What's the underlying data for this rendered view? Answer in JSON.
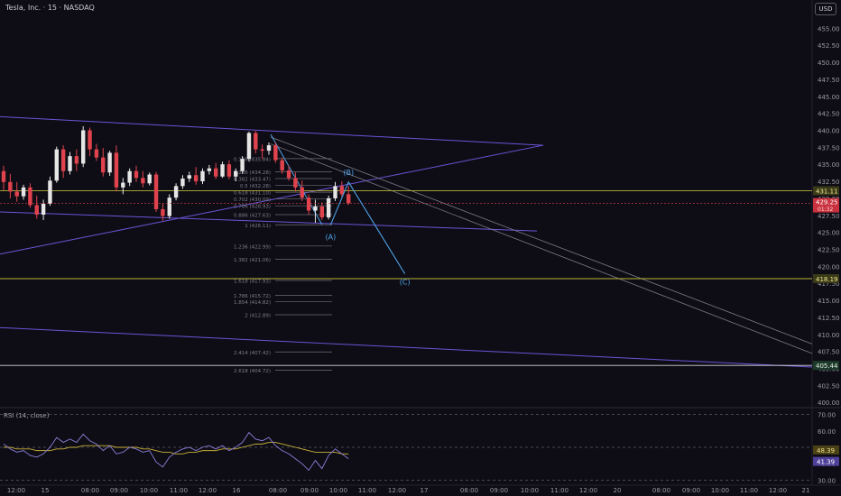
{
  "header": {
    "symbol": "Tesla, Inc. · 15 · NASDAQ",
    "currency": "USD"
  },
  "colors": {
    "bg": "#0e0d15",
    "up": "#e6e6e6",
    "down": "#e0434d",
    "channel": "#6a55d8",
    "fib": "#6d6d78",
    "level": "#b8b23a",
    "wave": "#4fa3e8",
    "rsi": "#8b7ed8",
    "rsiMa": "#c9b13a"
  },
  "chart_data": [
    {
      "type": "candlestick",
      "title": "",
      "yticks": [
        455.0,
        452.5,
        450.0,
        447.5,
        445.0,
        442.5,
        440.0,
        437.5,
        435.0,
        432.5,
        430.0,
        427.5,
        425.0,
        422.5,
        420.0,
        417.5,
        415.0,
        412.5,
        410.0,
        407.5,
        405.0,
        402.5,
        400.0
      ],
      "ylim": [
        399.5,
        456.5
      ],
      "xticks": [
        "12:00",
        "15",
        "08:00",
        "09:00",
        "10:00",
        "11:00",
        "12:00",
        "16",
        "08:00",
        "09:00",
        "10:00",
        "11:00",
        "12:00",
        "17",
        "08:00",
        "09:00",
        "10:00",
        "11:00",
        "12:00",
        "20",
        "08:00",
        "09:00",
        "10:00",
        "11:00",
        "12:00",
        "21"
      ],
      "x_note": "bar index (0..61 candles shown)",
      "candles": [
        [
          434.0,
          434.8,
          431.2,
          432.4
        ],
        [
          432.4,
          433.6,
          430.0,
          431.0
        ],
        [
          431.0,
          432.4,
          429.5,
          430.3
        ],
        [
          430.3,
          432.0,
          429.8,
          431.6
        ],
        [
          431.6,
          432.2,
          428.6,
          429.0
        ],
        [
          429.0,
          430.4,
          427.0,
          427.6
        ],
        [
          427.6,
          429.8,
          426.8,
          429.2
        ],
        [
          429.2,
          433.2,
          428.9,
          432.6
        ],
        [
          432.6,
          437.6,
          432.3,
          437.2
        ],
        [
          437.2,
          437.8,
          433.0,
          434.0
        ],
        [
          434.0,
          436.8,
          433.5,
          436.2
        ],
        [
          436.2,
          437.2,
          434.0,
          435.1
        ],
        [
          435.1,
          440.6,
          434.6,
          440.0
        ],
        [
          440.0,
          440.4,
          436.2,
          437.2
        ],
        [
          437.2,
          438.0,
          435.5,
          436.0
        ],
        [
          436.0,
          437.4,
          433.2,
          433.8
        ],
        [
          433.8,
          437.0,
          433.3,
          436.7
        ],
        [
          436.7,
          437.8,
          431.0,
          431.6
        ],
        [
          431.6,
          433.0,
          430.6,
          432.3
        ],
        [
          432.3,
          434.4,
          431.8,
          434.0
        ],
        [
          434.0,
          434.8,
          432.4,
          433.0
        ],
        [
          433.0,
          434.0,
          431.6,
          432.2
        ],
        [
          432.2,
          433.8,
          431.9,
          433.5
        ],
        [
          433.5,
          433.9,
          428.0,
          428.4
        ],
        [
          428.4,
          429.2,
          426.7,
          427.4
        ],
        [
          427.4,
          430.6,
          427.0,
          430.1
        ],
        [
          430.1,
          432.2,
          429.7,
          431.8
        ],
        [
          431.8,
          433.4,
          431.4,
          432.9
        ],
        [
          432.9,
          433.9,
          432.4,
          433.4
        ],
        [
          433.4,
          434.6,
          432.0,
          432.5
        ],
        [
          432.5,
          434.4,
          432.1,
          434.0
        ],
        [
          434.0,
          434.9,
          433.5,
          434.4
        ],
        [
          434.4,
          435.2,
          432.8,
          433.2
        ],
        [
          433.2,
          435.4,
          433.0,
          435.0
        ],
        [
          435.0,
          435.6,
          432.8,
          433.2
        ],
        [
          433.2,
          434.4,
          432.5,
          434.0
        ],
        [
          434.0,
          436.2,
          433.6,
          435.8
        ],
        [
          435.8,
          439.8,
          435.4,
          439.6
        ],
        [
          439.6,
          439.9,
          436.6,
          437.2
        ],
        [
          437.2,
          437.9,
          435.8,
          437.0
        ],
        [
          437.0,
          438.2,
          436.4,
          437.8
        ],
        [
          437.8,
          438.2,
          435.2,
          435.6
        ],
        [
          435.6,
          436.0,
          433.6,
          434.1
        ],
        [
          434.1,
          434.8,
          432.6,
          433.0
        ],
        [
          433.0,
          433.8,
          431.0,
          431.6
        ],
        [
          431.6,
          432.6,
          429.6,
          430.1
        ],
        [
          430.1,
          430.6,
          427.6,
          428.2
        ],
        [
          428.2,
          429.8,
          426.4,
          428.8
        ],
        [
          428.8,
          429.4,
          426.8,
          427.2
        ],
        [
          427.2,
          430.4,
          426.9,
          430.0
        ],
        [
          430.0,
          432.4,
          429.6,
          431.8
        ],
        [
          431.8,
          432.5,
          430.2,
          430.6
        ],
        [
          430.6,
          431.8,
          429.0,
          429.3
        ]
      ],
      "levels": [
        {
          "price": 431.11,
          "label": "431.11"
        },
        {
          "price": 418.19,
          "label": "418.19"
        },
        {
          "price": 405.44,
          "label": "405.44"
        }
      ],
      "current_price": {
        "price": 429.25,
        "label": "429.25",
        "countdown": "01:32"
      },
      "fib": [
        {
          "ratio": "0.146",
          "price": "435.84",
          "y": 435.84
        },
        {
          "ratio": "0.236",
          "price": "434.28",
          "y": 433.9
        },
        {
          "ratio": "0.382",
          "price": "433.47",
          "y": 432.9
        },
        {
          "ratio": "0.5",
          "price": "432.28",
          "y": 431.9
        },
        {
          "ratio": "0.618",
          "price": "431.10",
          "y": 430.9
        },
        {
          "ratio": "0.702",
          "price": "430.09",
          "y": 429.9
        },
        {
          "ratio": "0.786",
          "price": "428.93",
          "y": 428.9
        },
        {
          "ratio": "0.886",
          "price": "427.63",
          "y": 427.6
        },
        {
          "ratio": "1",
          "price": "426.11",
          "y": 426.11
        },
        {
          "ratio": "1.236",
          "price": "422.99",
          "y": 422.99
        },
        {
          "ratio": "1.382",
          "price": "421.06",
          "y": 421.06
        },
        {
          "ratio": "1.618",
          "price": "417.93",
          "y": 417.93
        },
        {
          "ratio": "1.786",
          "price": "415.72",
          "y": 415.72
        },
        {
          "ratio": "1.854",
          "price": "414.82",
          "y": 414.82
        },
        {
          "ratio": "2",
          "price": "412.89",
          "y": 412.89
        },
        {
          "ratio": "2.414",
          "price": "407.42",
          "y": 407.42
        },
        {
          "ratio": "2.618",
          "price": "404.72",
          "y": 404.72
        }
      ],
      "waves": [
        {
          "label": "(A)",
          "x": 49.5,
          "price": 426.1
        },
        {
          "label": "(B)",
          "x": 52.0,
          "price": 432.4
        },
        {
          "label": "(C)",
          "x": 60.5,
          "price": 418.9
        }
      ]
    },
    {
      "type": "line",
      "title": "RSI (14, close)",
      "ylim": [
        28,
        72
      ],
      "yticks": [
        70.0,
        60.0,
        50.0,
        40.0,
        30.0
      ],
      "series": [
        {
          "values": [
            52,
            49,
            47,
            48,
            45,
            44,
            46,
            50,
            56,
            53,
            55,
            53,
            58,
            54,
            52,
            48,
            51,
            46,
            47,
            50,
            49,
            47,
            48,
            41,
            38,
            44,
            47,
            49,
            50,
            48,
            50,
            51,
            49,
            51,
            48,
            50,
            53,
            59,
            55,
            54,
            56,
            51,
            48,
            46,
            43,
            40,
            36,
            42,
            37,
            45,
            49,
            46,
            43
          ]
        },
        {
          "values": [
            50,
            50,
            49,
            49,
            49,
            48,
            48,
            48,
            49,
            49,
            50,
            50,
            51,
            51,
            51,
            51,
            51,
            50,
            50,
            50,
            50,
            49,
            49,
            48,
            47,
            47,
            46,
            46,
            47,
            47,
            48,
            48,
            48,
            49,
            49,
            49,
            50,
            51,
            52,
            52,
            53,
            53,
            52,
            51,
            50,
            49,
            48,
            47,
            47,
            47,
            47,
            46,
            46
          ]
        }
      ],
      "labels": {
        "rsi": "41.39",
        "ma": "48.39"
      }
    }
  ]
}
